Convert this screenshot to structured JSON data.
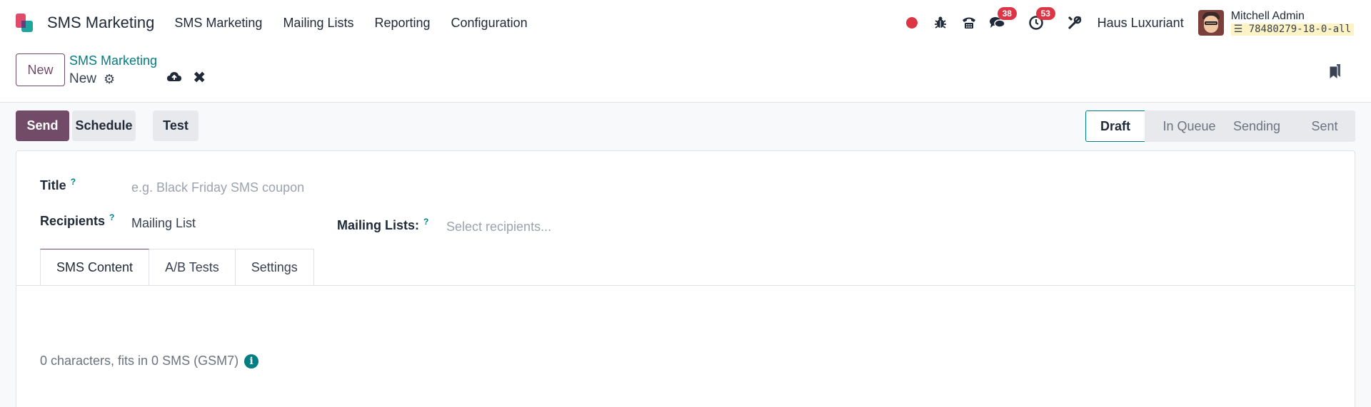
{
  "navbar": {
    "brand": "SMS Marketing",
    "menu": [
      "SMS Marketing",
      "Mailing Lists",
      "Reporting",
      "Configuration"
    ],
    "messages_badge": "38",
    "activities_badge": "53",
    "company": "Haus Luxuriant",
    "user_name": "Mitchell Admin",
    "db_name": "78480279-18-0-all"
  },
  "control_panel": {
    "new_label": "New",
    "breadcrumb": "SMS Marketing",
    "record_name": "New"
  },
  "actions": {
    "send": "Send",
    "schedule": "Schedule",
    "test": "Test"
  },
  "statusbar": {
    "stages": [
      "Draft",
      "In Queue",
      "Sending",
      "Sent"
    ],
    "active": "Draft"
  },
  "form": {
    "title_label": "Title",
    "title_placeholder": "e.g. Black Friday SMS coupon",
    "recipients_label": "Recipients",
    "recipients_value": "Mailing List",
    "mailing_lists_label": "Mailing Lists:",
    "mailing_lists_placeholder": "Select recipients...",
    "help_mark": "?"
  },
  "tabs": [
    "SMS Content",
    "A/B Tests",
    "Settings"
  ],
  "sms_info": "0 characters, fits in 0 SMS (GSM7)",
  "colors": {
    "primary": "#714b67",
    "teal": "#017e84",
    "danger": "#dc3545"
  },
  "icons": [
    "app-logo",
    "record-icon",
    "bug-icon",
    "phone-icon",
    "chat-icon",
    "clock-icon",
    "tools-icon",
    "gear-icon",
    "cloud-upload-icon",
    "close-icon",
    "bookmark-icon",
    "info-icon",
    "database-icon"
  ]
}
